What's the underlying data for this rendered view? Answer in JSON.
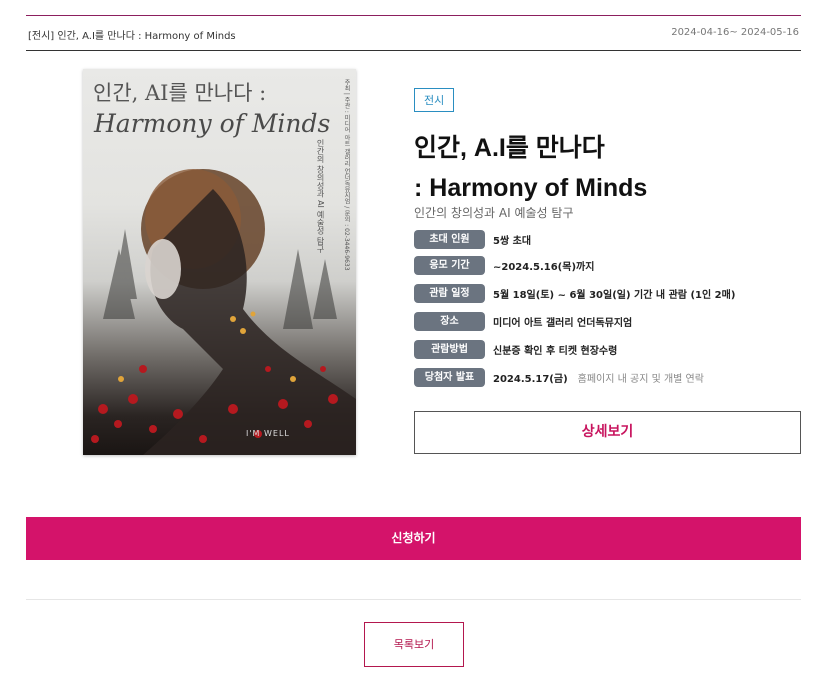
{
  "header": {
    "title": "[전시] 인간, A.I를 만나다 : Harmony of Minds",
    "dates": "2024-04-16~ 2024-05-16"
  },
  "poster": {
    "title_line1": "인간, AI를 만나다 :",
    "title_line2": "Harmony of Minds",
    "subtitle": "인간의 창의성과 AI 예술성 탐구",
    "info": "주최 | 주관 : 미디어 아트 갤러리 언더독뮤지엄 / 문의 : 02-3446-9633",
    "logo": "I'M WELL"
  },
  "event": {
    "category": "전시",
    "title_line1": "인간, A.I를 만나다",
    "title_line2": ": Harmony of Minds",
    "subtitle": "인간의 창의성과 AI 예술성 탐구"
  },
  "details": [
    {
      "label": "초대 인원",
      "value": "5쌍 초대",
      "note": ""
    },
    {
      "label": "응모 기간",
      "value": "~2024.5.16(목)까지",
      "note": ""
    },
    {
      "label": "관람 일정",
      "value": "5월 18일(토) ~ 6월 30일(일) 기간 내 관람 (1인 2매)",
      "note": ""
    },
    {
      "label": "장소",
      "value": "미디어 아트 갤러리 언더독뮤지엄",
      "note": ""
    },
    {
      "label": "관람방법",
      "value": "신분증 확인 후 티켓 현장수령",
      "note": ""
    },
    {
      "label": "당첨자 발표",
      "value": "2024.5.17(금)",
      "note": "홈페이지 내 공지 및 개별 연락"
    }
  ],
  "buttons": {
    "detail": "상세보기",
    "apply": "신청하기",
    "list": "목록보기"
  },
  "colors": {
    "accent": "#d4136a",
    "badge": "#2a8ec1",
    "label_bg": "#6b7480"
  }
}
